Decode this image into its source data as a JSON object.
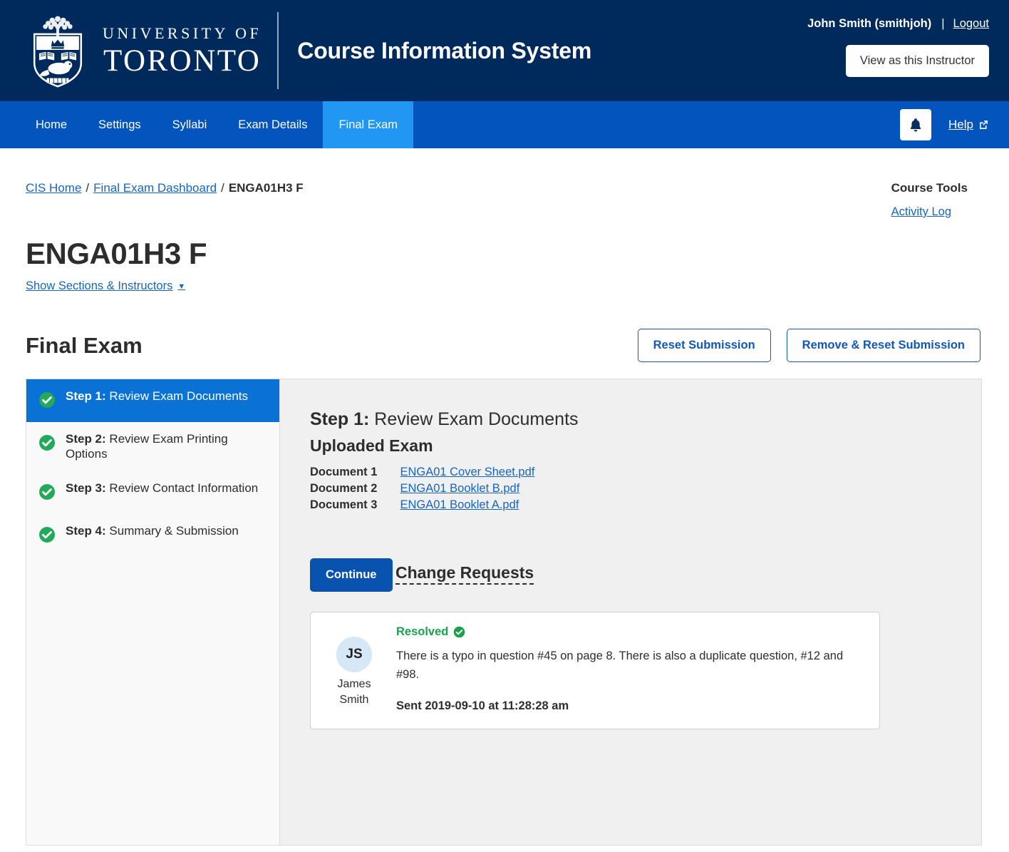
{
  "header": {
    "logo_line1": "UNIVERSITY OF",
    "logo_line2": "TORONTO",
    "logo_alt": "university-of-toronto-crest",
    "app_title": "Course Information System",
    "user_name": "John Smith (smithjoh)",
    "separator": "|",
    "logout_label": "Logout",
    "view_as_instructor_label": "View as this Instructor"
  },
  "nav": {
    "items": [
      {
        "label": "Home",
        "active": false
      },
      {
        "label": "Settings",
        "active": false
      },
      {
        "label": "Syllabi",
        "active": false
      },
      {
        "label": "Exam Details",
        "active": false
      },
      {
        "label": "Final Exam",
        "active": true
      }
    ],
    "notifications_icon": "bell-icon",
    "help_label": "Help",
    "help_external_icon": "external-link-icon"
  },
  "breadcrumb": {
    "items": [
      {
        "label": "CIS Home",
        "link": true
      },
      {
        "label": "Final Exam Dashboard",
        "link": true
      },
      {
        "label": "ENGA01H3 F",
        "link": false
      }
    ],
    "separator": "/"
  },
  "course_tools": {
    "title": "Course Tools",
    "links": [
      "Activity Log"
    ]
  },
  "page": {
    "title": "ENGA01H3 F",
    "show_sections_label": "Show Sections & Instructors",
    "caret_icon": "chevron-down-icon"
  },
  "section": {
    "title": "Final Exam",
    "reset_submission_label": "Reset Submission",
    "remove_reset_submission_label": "Remove & Reset Submission"
  },
  "wizard": {
    "steps": [
      {
        "num": "Step 1:",
        "name": " Review Exam Documents",
        "complete": true,
        "active": true
      },
      {
        "num": "Step 2:",
        "name": " Review Exam Printing Options",
        "complete": true,
        "active": false
      },
      {
        "num": "Step 3:",
        "name": " Review Contact Information",
        "complete": true,
        "active": false
      },
      {
        "num": "Step 4:",
        "name": " Summary & Submission",
        "complete": true,
        "active": false
      }
    ]
  },
  "panel": {
    "step_num": "Step 1:",
    "step_name": " Review Exam Documents",
    "uploaded_exam_heading": "Uploaded Exam",
    "documents": [
      {
        "label": "Document 1",
        "file": "ENGA01 Cover Sheet.pdf"
      },
      {
        "label": "Document 2",
        "file": "ENGA01 Booklet B.pdf"
      },
      {
        "label": "Document 3",
        "file": "ENGA01 Booklet A.pdf"
      }
    ],
    "continue_label": "Continue"
  },
  "change_requests": {
    "title": "Change Requests",
    "items": [
      {
        "initials": "JS",
        "author_first": "James",
        "author_last": "Smith",
        "status": "Resolved",
        "status_icon": "check-circle-icon",
        "message": "There is a typo in question #45 on page 8. There is also a duplicate question, #12 and #98.",
        "sent": "Sent 2019-09-10 at 11:28:28 am"
      }
    ]
  },
  "colors": {
    "header_navy": "#002a5c",
    "nav_blue": "#0355bd",
    "nav_active_blue": "#2196f3",
    "link_blue": "#1665c1",
    "primary_button_blue": "#0a52b0",
    "success_green": "#1aa24a",
    "panel_gray": "#f0f0f0"
  }
}
